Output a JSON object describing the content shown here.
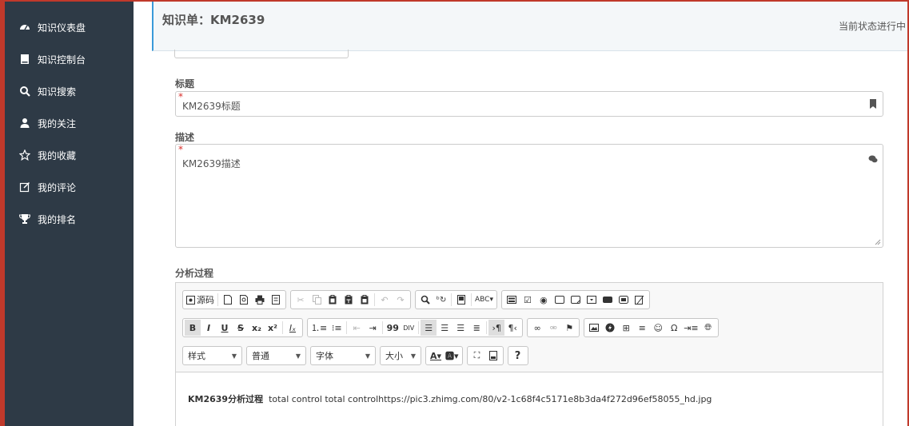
{
  "sidebar": {
    "items": [
      {
        "label": "知识仪表盘",
        "icon": "dashboard-icon"
      },
      {
        "label": "知识控制台",
        "icon": "book-icon"
      },
      {
        "label": "知识搜索",
        "icon": "search-icon"
      },
      {
        "label": "我的关注",
        "icon": "user-icon"
      },
      {
        "label": "我的收藏",
        "icon": "star-outline-icon"
      },
      {
        "label": "我的评论",
        "icon": "edit-comment-icon"
      },
      {
        "label": "我的排名",
        "icon": "trophy-icon"
      }
    ]
  },
  "header": {
    "title": "知识单：KM2639",
    "status": "当前状态进行中"
  },
  "form": {
    "title_label": "标题",
    "title_required": "*",
    "title_value": "KM2639标题",
    "desc_label": "描述",
    "desc_required": "*",
    "desc_value": "KM2639描述",
    "analysis_label": "分析过程"
  },
  "editor": {
    "source_label": "源码",
    "style_combo": "样式",
    "format_combo": "普通",
    "font_combo": "字体",
    "size_combo": "大小",
    "help_label": "?",
    "content_bold": "KM2639分析过程",
    "content_text": "total control total controlhttps://pic3.zhimg.com/80/v2-1c68f4c5171e8b3da4f272d96ef58055_hd.jpg"
  },
  "colors": {
    "sidebar_bg": "#2e3a46",
    "accent": "#3a9ad9",
    "frame": "#c0392b",
    "required": "#d9302c"
  }
}
